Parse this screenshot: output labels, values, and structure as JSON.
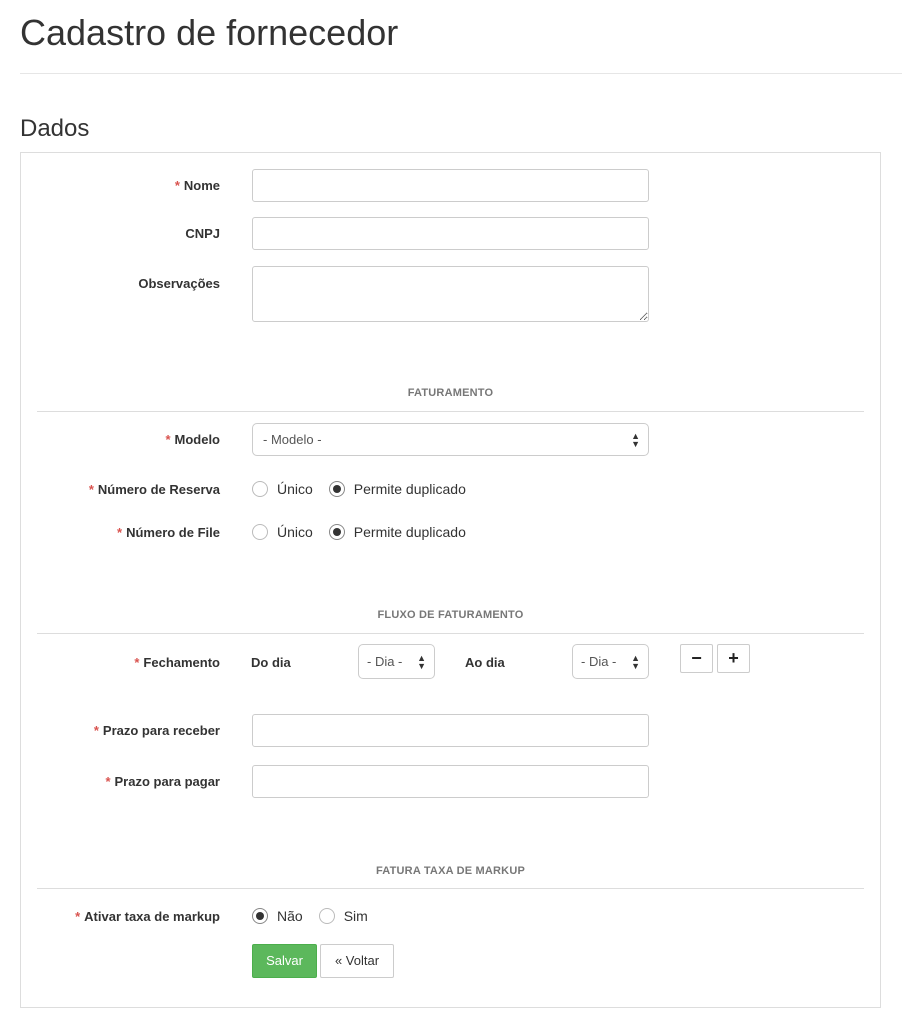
{
  "page": {
    "title": "Cadastro de fornecedor"
  },
  "section": {
    "title": "Dados"
  },
  "fields": {
    "nome": {
      "label": "Nome",
      "value": ""
    },
    "cnpj": {
      "label": "CNPJ",
      "value": ""
    },
    "observacoes": {
      "label": "Observações",
      "value": ""
    },
    "modelo": {
      "label": "Modelo",
      "selected": "- Modelo -"
    },
    "numero_reserva": {
      "label": "Número de Reserva",
      "options": [
        "Único",
        "Permite duplicado"
      ],
      "selected": "Permite duplicado"
    },
    "numero_file": {
      "label": "Número de File",
      "options": [
        "Único",
        "Permite duplicado"
      ],
      "selected": "Permite duplicado"
    },
    "fechamento": {
      "label": "Fechamento",
      "do_dia_label": "Do dia",
      "do_dia_selected": "- Dia -",
      "ao_dia_label": "Ao dia",
      "ao_dia_selected": "- Dia -",
      "remove_label": "−",
      "add_label": "+"
    },
    "prazo_receber": {
      "label": "Prazo para receber",
      "value": ""
    },
    "prazo_pagar": {
      "label": "Prazo para pagar",
      "value": ""
    },
    "ativar_markup": {
      "label": "Ativar taxa de markup",
      "options": [
        "Não",
        "Sim"
      ],
      "selected": "Não"
    }
  },
  "subheads": {
    "faturamento": "FATURAMENTO",
    "fluxo": "FLUXO DE FATURAMENTO",
    "markup": "FATURA TAXA DE MARKUP"
  },
  "required_marker": "*",
  "select_arrows": {
    "up": "▲",
    "down": "▼"
  },
  "buttons": {
    "save": "Salvar",
    "back": "« Voltar"
  },
  "colors": {
    "save_button": "#5cb85c",
    "required": "#d9534f"
  }
}
